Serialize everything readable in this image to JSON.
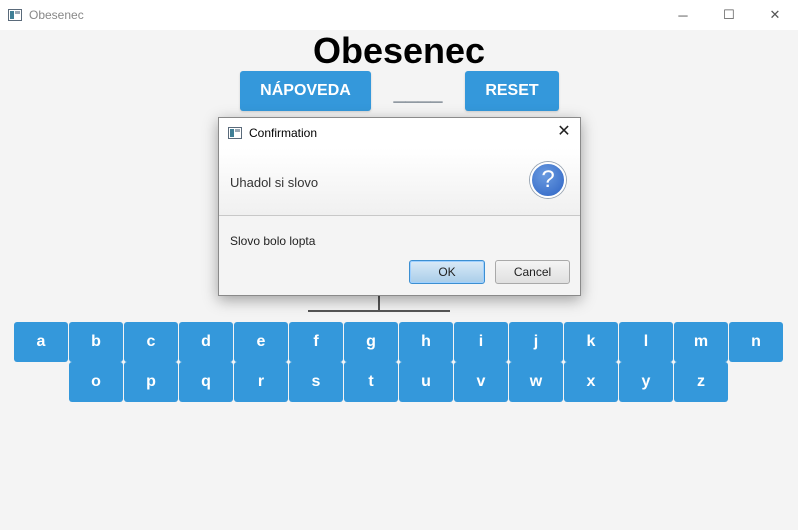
{
  "window": {
    "title": "Obesenec",
    "minimize": "─",
    "maximize": "☐",
    "close": "✕"
  },
  "game": {
    "title": "Obesenec",
    "hint_label": "NÁPOVEDA",
    "reset_label": "RESET",
    "word_mask": "____"
  },
  "keyboard": {
    "row1": [
      "a",
      "b",
      "c",
      "d",
      "e",
      "f",
      "g",
      "h",
      "i",
      "j",
      "k",
      "l",
      "m",
      "n"
    ],
    "row2": [
      "o",
      "p",
      "q",
      "r",
      "s",
      "t",
      "u",
      "v",
      "w",
      "x",
      "y",
      "z"
    ]
  },
  "dialog": {
    "title": "Confirmation",
    "close": "✕",
    "header": "Uhadol si slovo",
    "icon": "?",
    "content": "Slovo bolo lopta",
    "ok_label": "OK",
    "cancel_label": "Cancel"
  },
  "colors": {
    "accent": "#3498db",
    "background": "#f4f4f4"
  }
}
